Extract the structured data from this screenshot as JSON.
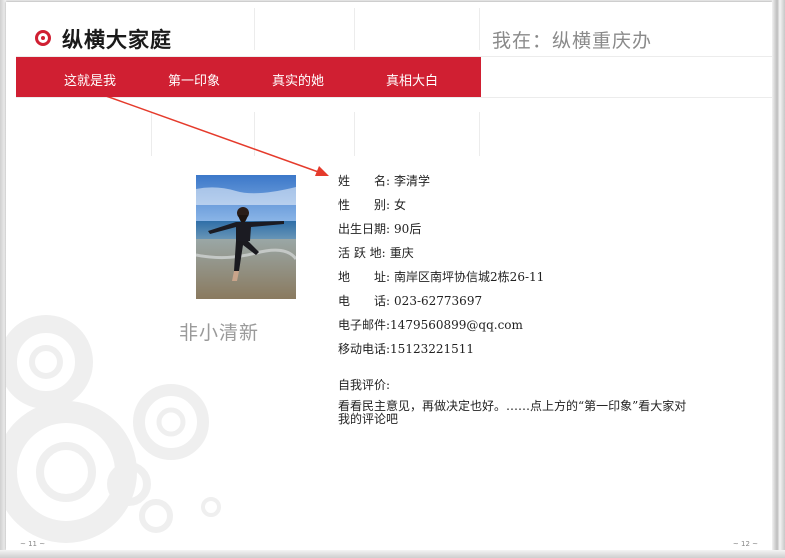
{
  "header": {
    "brand": "纵横大家庭",
    "location": "我在：纵横重庆办"
  },
  "nav": {
    "items": [
      {
        "label": "这就是我"
      },
      {
        "label": "第一印象"
      },
      {
        "label": "真实的她"
      },
      {
        "label": "真相大白"
      }
    ]
  },
  "profile": {
    "caption": "非小清新",
    "fields": [
      {
        "label": "姓　　名:",
        "value": "李清学"
      },
      {
        "label": "性　　别:",
        "value": "女"
      },
      {
        "label": "出生日期:",
        "value": "90后"
      },
      {
        "label": "活 跃 地:",
        "value": "重庆"
      },
      {
        "label": "地　　址:",
        "value": "南岸区南坪协信城2栋26-11"
      },
      {
        "label": "电　　话:",
        "value": "023-62773697"
      },
      {
        "label": "电子邮件:",
        "value": "1479560899@qq.com"
      },
      {
        "label": "移动电话:",
        "value": "15123221511"
      }
    ],
    "evaluation_label": "自我评价:",
    "evaluation_text": "看看民主意见，再做决定也好。……点上方的“第一印象”看大家对我的评论吧"
  },
  "footer": {
    "page_left": "~ 11 ~",
    "page_right": "~ 12 ~"
  },
  "colors": {
    "accent": "#d01f32",
    "arrow": "#e53b2c"
  }
}
